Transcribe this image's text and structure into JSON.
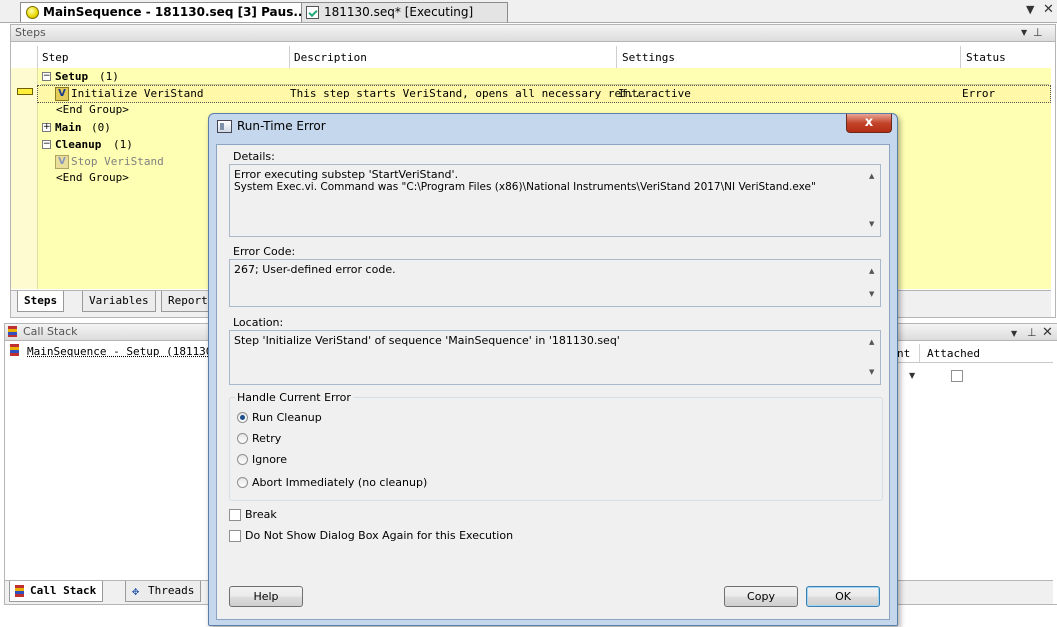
{
  "doc_tabs": [
    {
      "label": "MainSequence - 181130.seq [3]  Paus..."
    },
    {
      "label": "181130.seq* [Executing]"
    }
  ],
  "steps_panel": {
    "title": "Steps",
    "columns": {
      "step": "Step",
      "description": "Description",
      "settings": "Settings",
      "status": "Status"
    },
    "rows": {
      "setup": {
        "name": "Setup",
        "count": "(1)"
      },
      "init": {
        "name": "Initialize VeriStand",
        "description": "This step starts VeriStand, opens all necessary ref...",
        "settings": "Interactive",
        "status": "Error"
      },
      "end_group_1": "<End Group>",
      "main": {
        "name": "Main",
        "count": "(0)"
      },
      "cleanup": {
        "name": "Cleanup",
        "count": "(1)"
      },
      "stop": {
        "name": "Stop VeriStand"
      },
      "end_group_2": "<End Group>"
    },
    "tabs": [
      "Steps",
      "Variables",
      "Report"
    ]
  },
  "callstack_panel": {
    "title": "Call Stack",
    "row": "MainSequence - Setup (181130.s",
    "tabs": [
      "Call Stack",
      "Threads"
    ],
    "right_col_fragment": "nt",
    "right_col_attached": "Attached"
  },
  "dialog": {
    "title": "Run-Time Error",
    "close_glyph": "x",
    "details_label": "Details:",
    "details_line1": "Error executing substep 'StartVeriStand'.",
    "details_line2": "System Exec.vi. Command was \"C:\\Program Files (x86)\\National Instruments\\VeriStand 2017\\NI VeriStand.exe\"",
    "error_code_label": "Error Code:",
    "error_code": "267; User-defined error code.",
    "location_label": "Location:",
    "location": "Step 'Initialize VeriStand' of sequence 'MainSequence' in '181130.seq'",
    "handle_group": "Handle Current Error",
    "options": [
      "Run Cleanup",
      "Retry",
      "Ignore",
      "Abort Immediately (no cleanup)"
    ],
    "selected_option": "Run Cleanup",
    "break_label": "Break",
    "dont_show_label": "Do Not Show Dialog Box Again for this Execution",
    "help_button": "Help",
    "copy_button": "Copy",
    "ok_button": "OK"
  },
  "colors": {
    "step_background": "#ffffb3",
    "dialog_frame": "#c5d7ec",
    "close_button": "#c4442b"
  }
}
